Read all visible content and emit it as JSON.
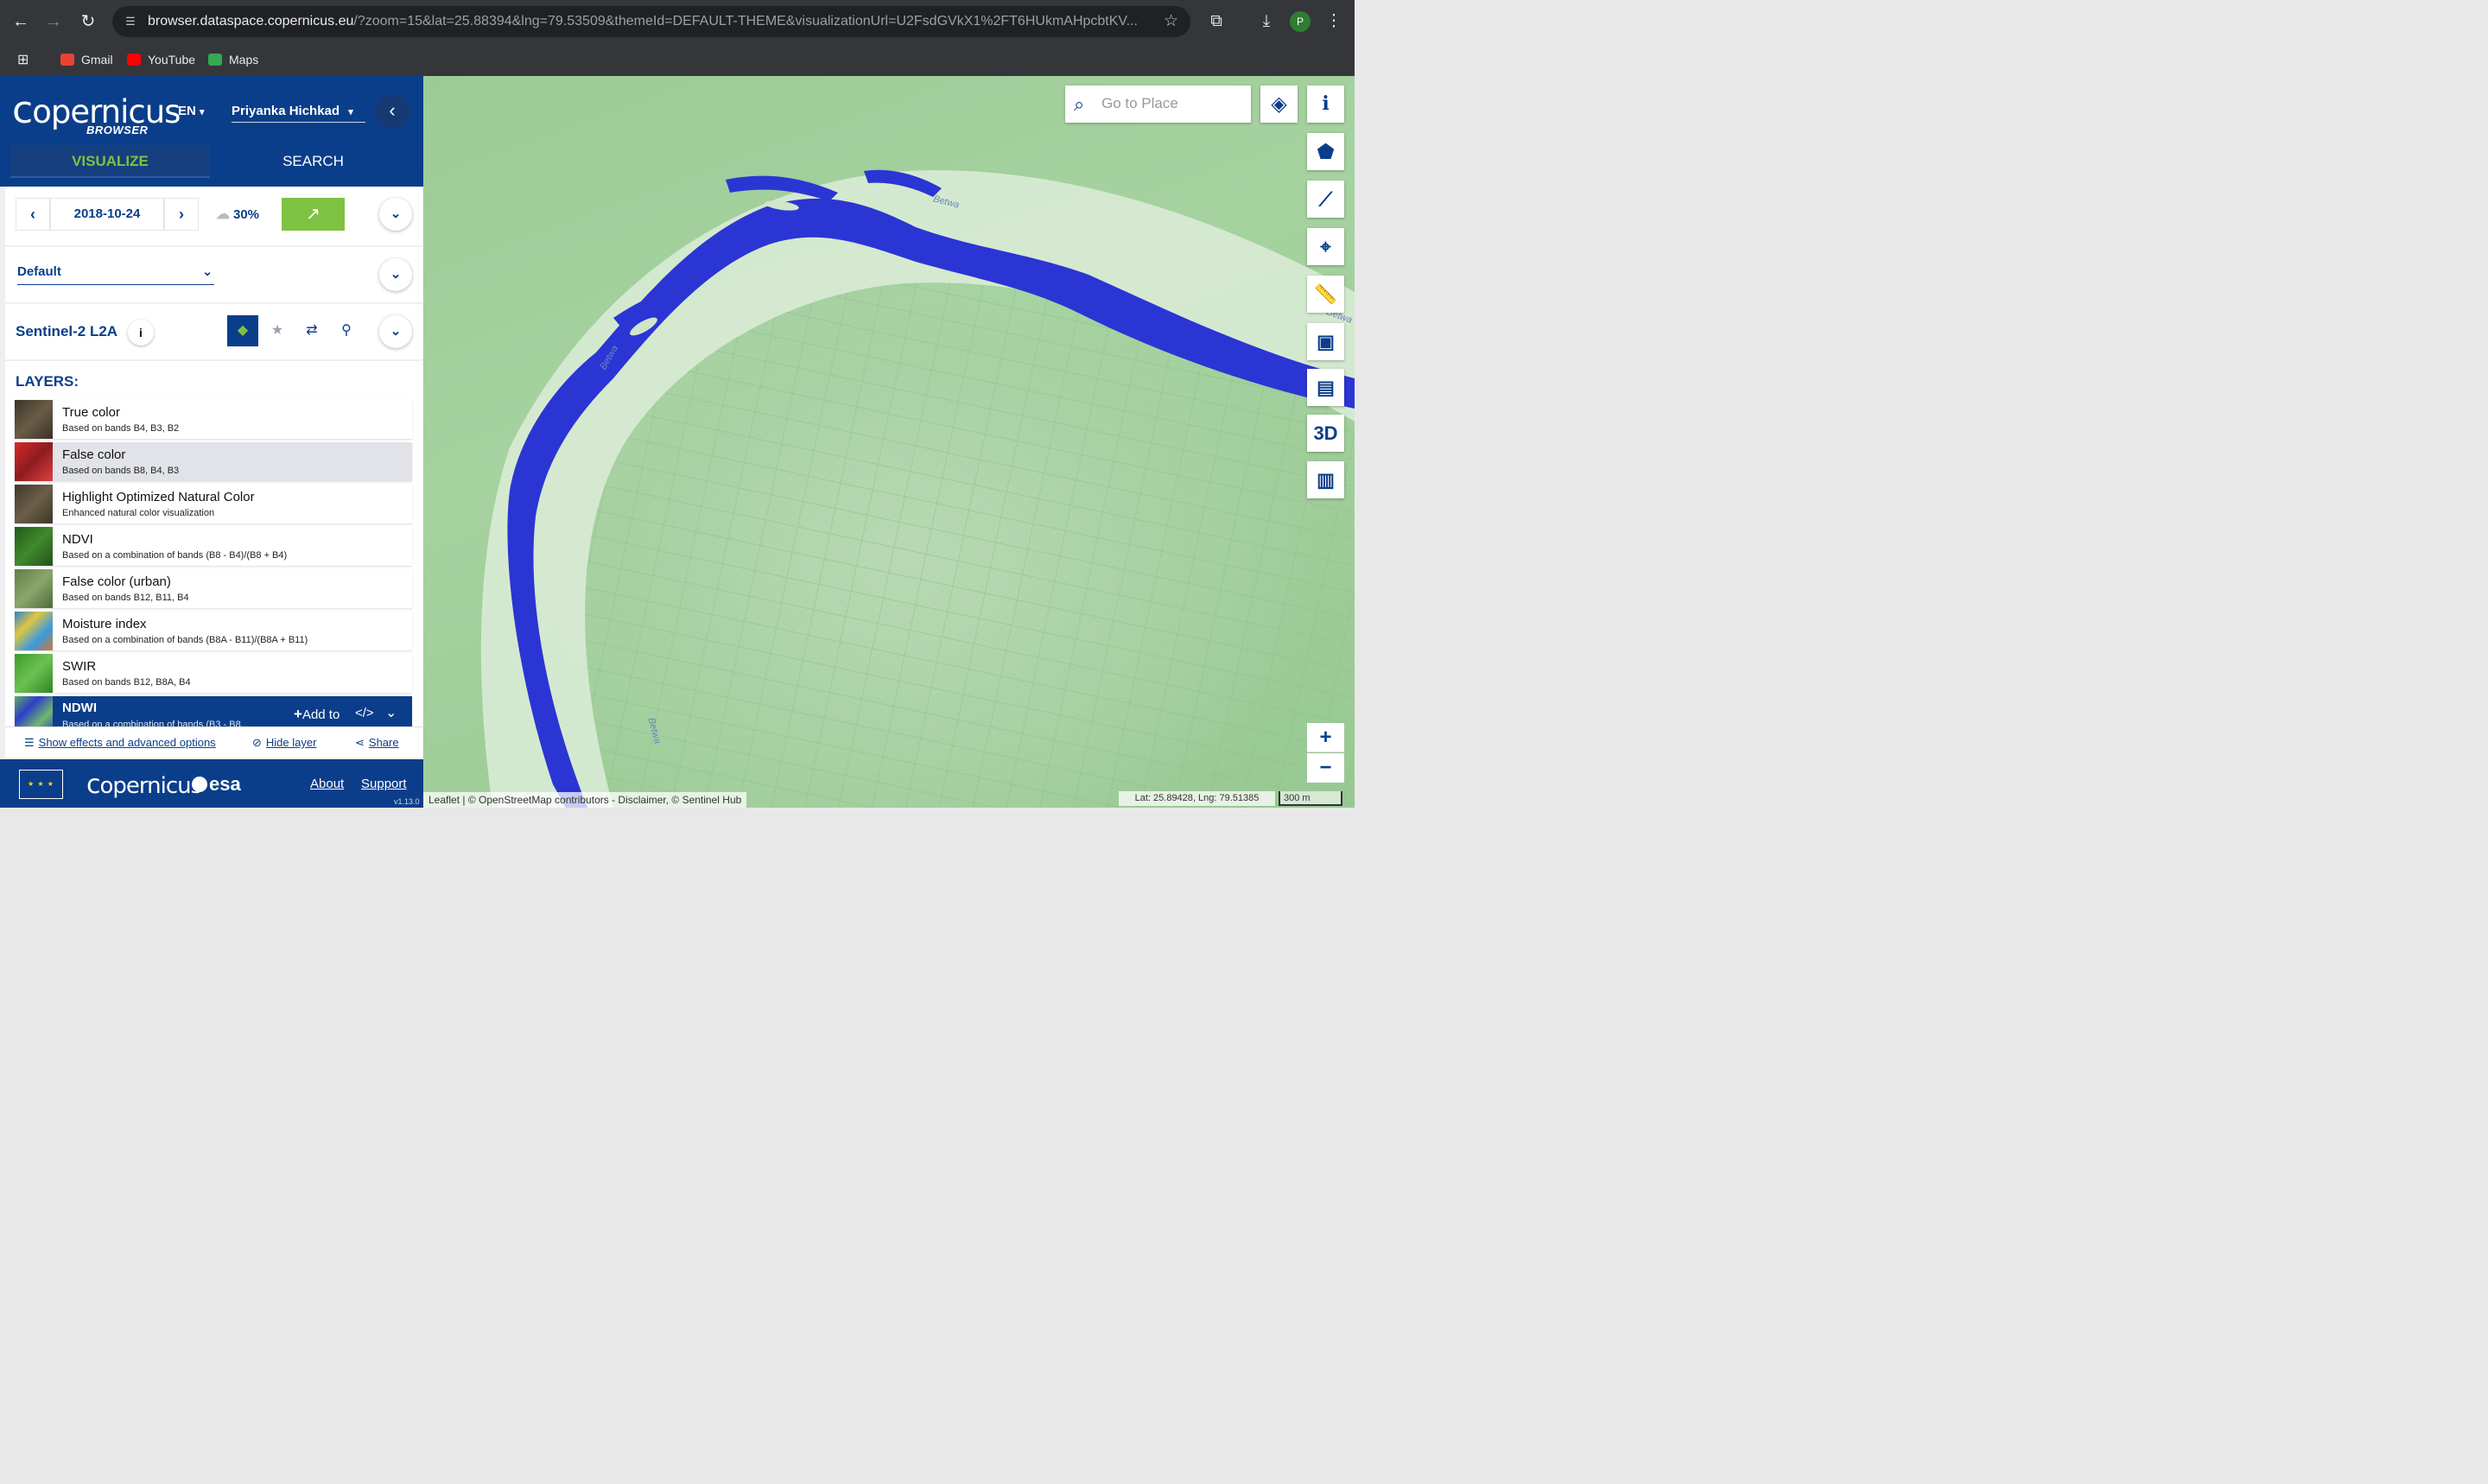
{
  "browser": {
    "url_host": "browser.dataspace.copernicus.eu",
    "url_rest": "/?zoom=15&lat=25.88394&lng=79.53509&themeId=DEFAULT-THEME&visualizationUrl=U2FsdGVkX1%2FT6HUkmAHpcbtKV...",
    "profile_initial": "P",
    "bookmarks": [
      {
        "label": "Gmail",
        "icon": "gmail-icon",
        "color": "#ea4335"
      },
      {
        "label": "YouTube",
        "icon": "youtube-icon",
        "color": "#ff0000"
      },
      {
        "label": "Maps",
        "icon": "maps-icon",
        "color": "#34a853"
      }
    ]
  },
  "header": {
    "logo_text": "opernicus",
    "logo_c": "c",
    "logo_sub": "BROWSER",
    "language": "EN",
    "user_name": "Priyanka Hichkad",
    "tabs": {
      "visualize": "VISUALIZE",
      "search": "SEARCH"
    }
  },
  "date_panel": {
    "date": "2018-10-24",
    "cloud_cover": "30%"
  },
  "theme": {
    "selected": "Default"
  },
  "collection": {
    "name": "Sentinel-2 L2A"
  },
  "layers": {
    "title": "LAYERS:",
    "items": [
      {
        "name": "True color",
        "desc": "Based on bands B4, B3, B2",
        "thumb": "#4a4032"
      },
      {
        "name": "False color",
        "desc": "Based on bands B8, B4, B3",
        "thumb": "#c6252b"
      },
      {
        "name": "Highlight Optimized Natural Color",
        "desc": "Enhanced natural color visualization",
        "thumb": "#4d4434"
      },
      {
        "name": "NDVI",
        "desc": "Based on a combination of bands (B8 - B4)/(B8 + B4)",
        "thumb": "#2f6b25"
      },
      {
        "name": "False color (urban)",
        "desc": "Based on bands B12, B11, B4",
        "thumb": "#6d8a52"
      },
      {
        "name": "Moisture index",
        "desc": "Based on a combination of bands (B8A - B11)/(B8A + B11)",
        "thumb": "#3d8fd0"
      },
      {
        "name": "SWIR",
        "desc": "Based on bands B12, B8A, B4",
        "thumb": "#4aa33a"
      },
      {
        "name": "NDWI",
        "desc": "Based on a combination of bands (B3 - B8...",
        "thumb": "#4f9b56"
      }
    ],
    "add_to_label": "Add to",
    "code_label": "</>"
  },
  "effects": {
    "show_effects": "Show effects and advanced options",
    "hide_layer": "Hide layer",
    "share": "Share"
  },
  "footer": {
    "eu_stars": "★ ★ ★",
    "logo_text": "opernicus",
    "logo_c": "c",
    "esa": "esa",
    "about": "About",
    "support": "Support",
    "version": "v1.13.0"
  },
  "map": {
    "search_placeholder": "Go to Place",
    "river_labels": [
      "Betwa",
      "Betwa",
      "Betwa",
      "Betwa"
    ],
    "tools": {
      "info": "i",
      "three_d": "3D"
    },
    "attribution": "Leaflet | © OpenStreetMap contributors - Disclaimer, © Sentinel Hub",
    "coords": "Lat: 25.89428, Lng: 79.51385",
    "scale": "300 m",
    "colors": {
      "water": "#2b35d4",
      "vegetation": "#8cc585",
      "sand": "#dcecd8"
    }
  }
}
